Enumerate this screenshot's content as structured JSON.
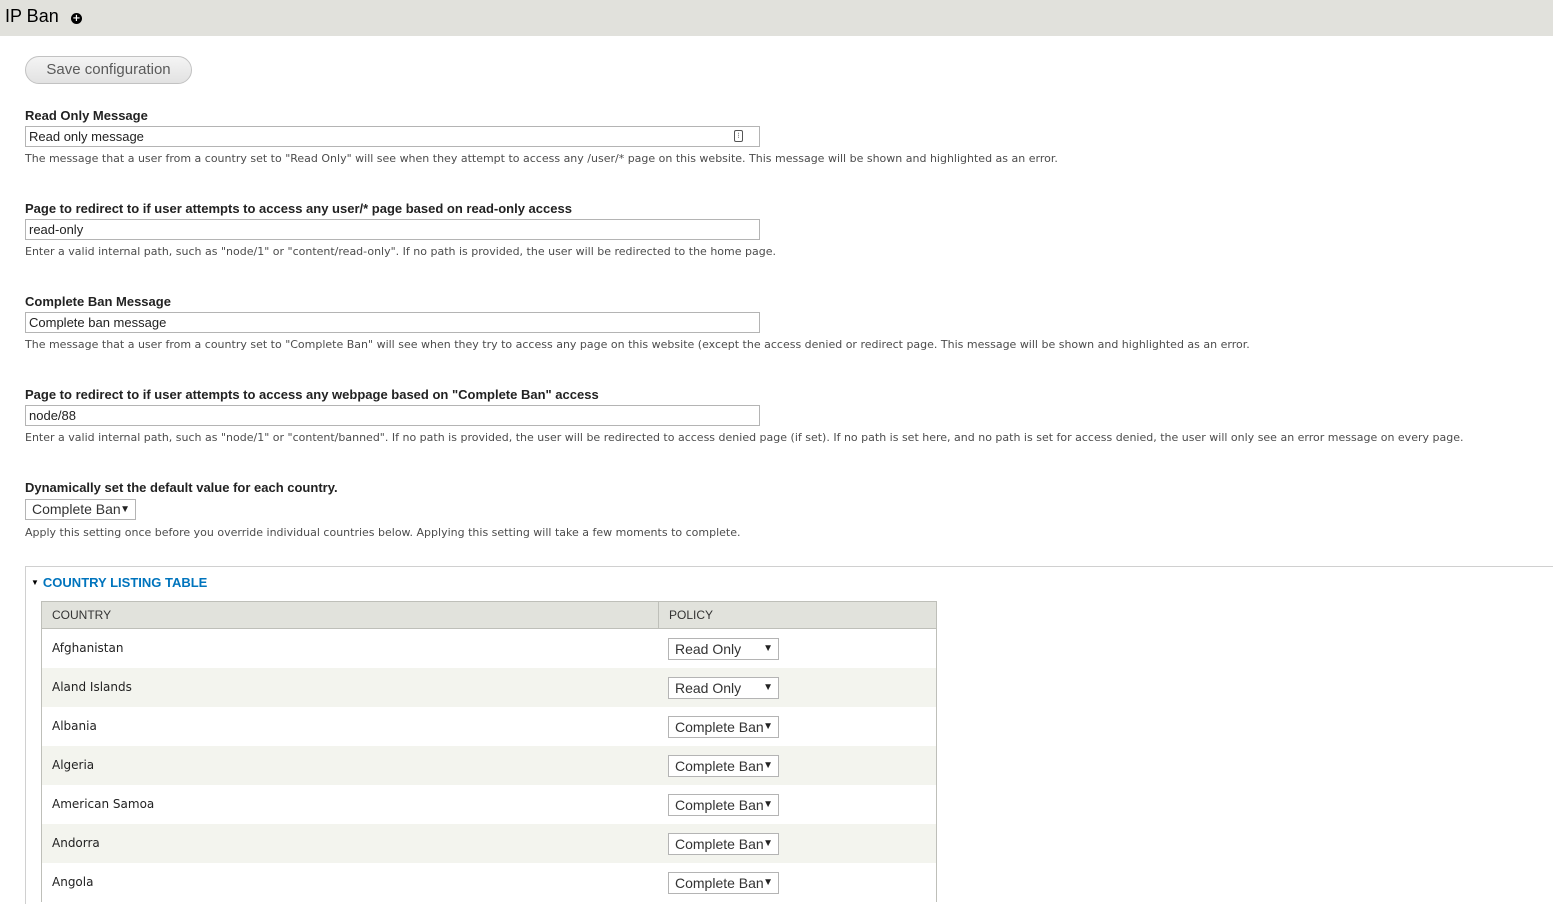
{
  "header": {
    "title": "IP Ban",
    "shortcut_icon": "add-shortcut-icon"
  },
  "actions": {
    "save_label": "Save configuration"
  },
  "fields": {
    "read_only_message": {
      "label": "Read Only Message",
      "value": "Read only message",
      "description": "The message that a user from a country set to \"Read Only\" will see when they attempt to access any /user/* page on this website. This message will be shown and highlighted as an error."
    },
    "read_only_redirect": {
      "label": "Page to redirect to if user attempts to access any user/* page based on read-only access",
      "value": "read-only",
      "description": "Enter a valid internal path, such as \"node/1\" or \"content/read-only\". If no path is provided, the user will be redirected to the home page."
    },
    "complete_ban_message": {
      "label": "Complete Ban Message",
      "value": "Complete ban message",
      "description": "The message that a user from a country set to \"Complete Ban\" will see when they try to access any page on this website (except the access denied or redirect page. This message will be shown and highlighted as an error."
    },
    "complete_ban_redirect": {
      "label": "Page to redirect to if user attempts to access any webpage based on \"Complete Ban\" access",
      "value": "node/88",
      "description": "Enter a valid internal path, such as \"node/1\" or \"content/banned\". If no path is provided, the user will be redirected to access denied page (if set). If no path is set here, and no path is set for access denied, the user will only see an error message on every page."
    },
    "default_value": {
      "label": "Dynamically set the default value for each country.",
      "selected": "Complete Ban",
      "description": "Apply this setting once before you override individual countries below. Applying this setting will take a few moments to complete."
    }
  },
  "country_table": {
    "legend": "COUNTRY LISTING TABLE",
    "headers": {
      "country": "COUNTRY",
      "policy": "POLICY"
    },
    "rows": [
      {
        "country": "Afghanistan",
        "policy": "Read Only"
      },
      {
        "country": "Aland Islands",
        "policy": "Read Only"
      },
      {
        "country": "Albania",
        "policy": "Complete Ban"
      },
      {
        "country": "Algeria",
        "policy": "Complete Ban"
      },
      {
        "country": "American Samoa",
        "policy": "Complete Ban"
      },
      {
        "country": "Andorra",
        "policy": "Complete Ban"
      },
      {
        "country": "Angola",
        "policy": "Complete Ban"
      }
    ]
  }
}
